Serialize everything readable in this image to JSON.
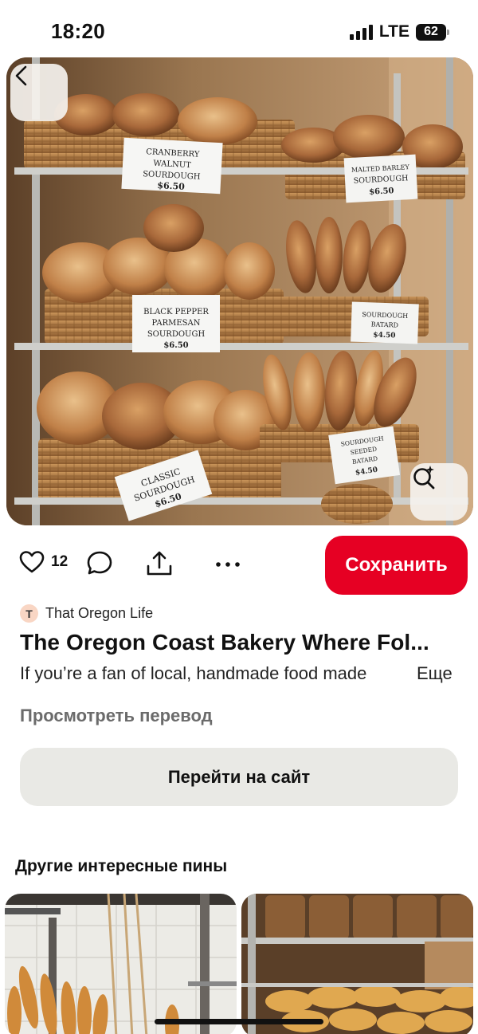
{
  "status_bar": {
    "time": "18:20",
    "network": "LTE",
    "battery": "62"
  },
  "hero": {
    "labels": {
      "cranberry": [
        "CRANBERRY",
        "WALNUT",
        "SOURDOUGH",
        "$6.50"
      ],
      "malted": [
        "MALTED BARLEY",
        "SOURDOUGH",
        "$6.50"
      ],
      "black_pepper": [
        "BLACK PEPPER",
        "PARMESAN",
        "SOURDOUGH",
        "$6.50"
      ],
      "batard": [
        "SOURDOUGH",
        "BATARD",
        "$4.50"
      ],
      "classic": [
        "CLASSIC",
        "SOURDOUGH",
        "$6.50"
      ],
      "seeded": [
        "SOURDOUGH",
        "SEEDED",
        "BATARD",
        "$4.50"
      ]
    }
  },
  "actions": {
    "like_count": "12",
    "save_label": "Сохранить"
  },
  "pin": {
    "author_initial": "T",
    "author_name": "That Oregon Life",
    "title": "The Oregon Coast Bakery Where Fol...",
    "description": "If you’re a fan of local, handmade food made",
    "more_label": "Еще",
    "translate_label": "Просмотреть перевод",
    "visit_label": "Перейти на сайт"
  },
  "more_pins": {
    "title": "Другие интересные пины"
  },
  "colors": {
    "brand_red": "#e60023",
    "secondary_button": "#e9e9e5"
  }
}
